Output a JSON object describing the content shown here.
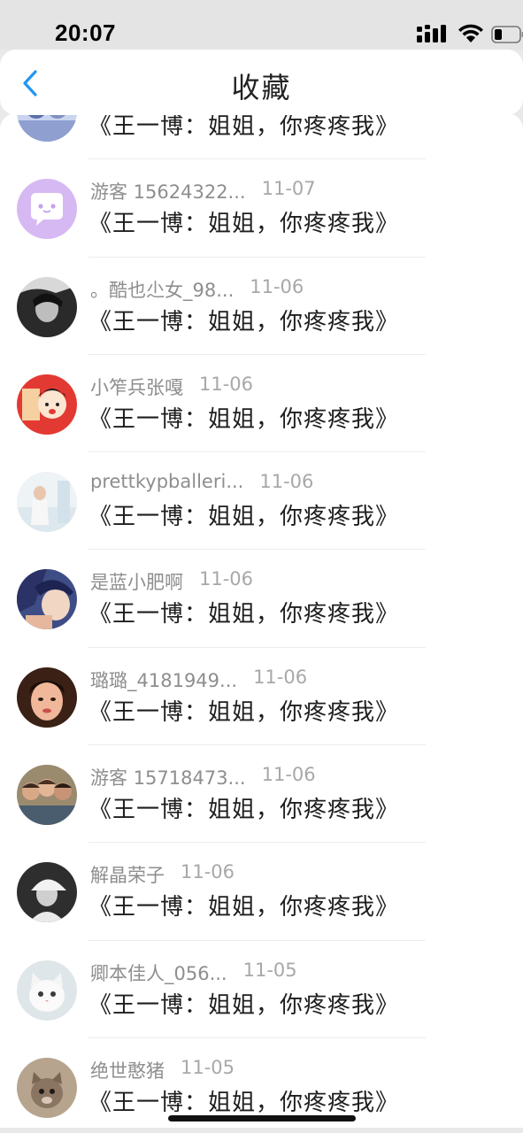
{
  "status_bar": {
    "time": "20:07"
  },
  "header": {
    "title": "收藏",
    "back_icon": "chevron-left-icon",
    "accent": "#2196f3"
  },
  "favorites": [
    {
      "user": "",
      "date": "",
      "title": "《王一博：姐姐，你疼疼我》",
      "avatar": "cartoon-avatar"
    },
    {
      "user": "游客 15624322...",
      "date": "11-07",
      "title": "《王一博：姐姐，你疼疼我》",
      "avatar": "chat-bubble-avatar"
    },
    {
      "user": "。酷也尐女_98...",
      "date": "11-06",
      "title": "《王一博：姐姐，你疼疼我》",
      "avatar": "bw-photo-avatar"
    },
    {
      "user": "小笮兵张嘎",
      "date": "11-06",
      "title": "《王一博：姐姐，你疼疼我》",
      "avatar": "cartoon-red-avatar"
    },
    {
      "user": "prettkypballeri...",
      "date": "11-06",
      "title": "《王一博：姐姐，你疼疼我》",
      "avatar": "light-photo-avatar"
    },
    {
      "user": "是蓝小肥啊",
      "date": "11-06",
      "title": "《王一博：姐姐，你疼疼我》",
      "avatar": "anime-avatar"
    },
    {
      "user": "璐璐_4181949...",
      "date": "11-06",
      "title": "《王一博：姐姐，你疼疼我》",
      "avatar": "selfie-avatar"
    },
    {
      "user": "游客 15718473...",
      "date": "11-06",
      "title": "《王一博：姐姐，你疼疼我》",
      "avatar": "group-photo-avatar"
    },
    {
      "user": "解晶荣子",
      "date": "11-06",
      "title": "《王一博：姐姐，你疼疼我》",
      "avatar": "bw-cap-avatar"
    },
    {
      "user": "卿本佳人_056...",
      "date": "11-05",
      "title": "《王一博：姐姐，你疼疼我》",
      "avatar": "cat-avatar"
    },
    {
      "user": "绝世憨猪",
      "date": "11-05",
      "title": "《王一博：姐姐，你疼疼我》",
      "avatar": "kitten-avatar"
    }
  ]
}
